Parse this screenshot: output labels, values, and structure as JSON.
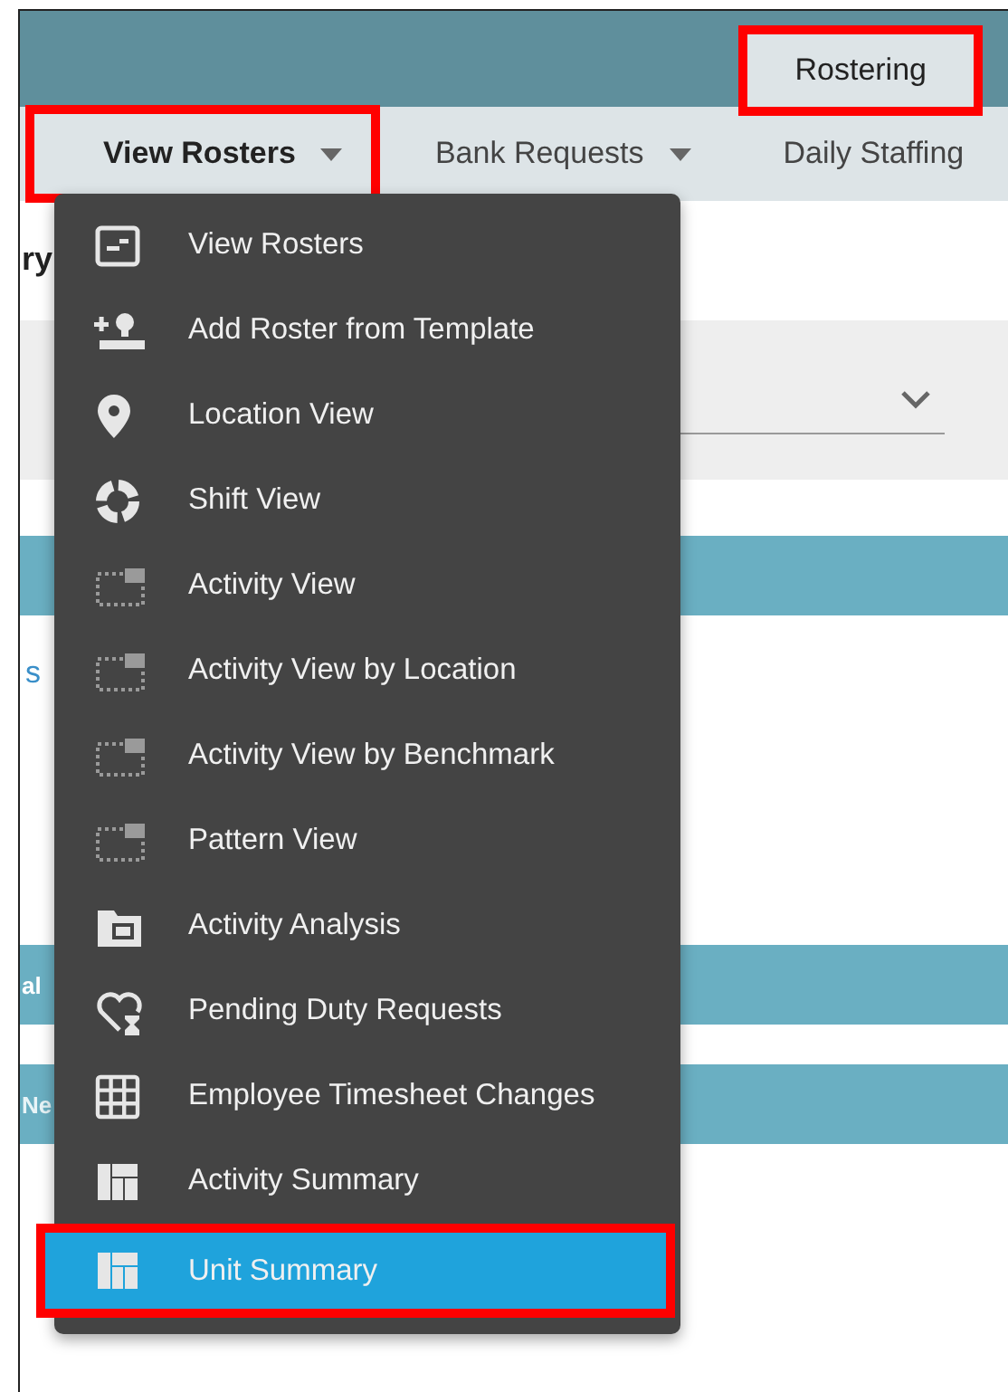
{
  "top_bar": {
    "tabs": [
      {
        "label": "Rostering",
        "selected": true,
        "highlighted": true
      }
    ]
  },
  "nav": {
    "items": [
      {
        "label": "View Rosters",
        "selected": true,
        "highlighted": true,
        "has_caret": true
      },
      {
        "label": "Bank Requests",
        "selected": false,
        "highlighted": false,
        "has_caret": true
      },
      {
        "label": "Daily Staffing",
        "selected": false,
        "highlighted": false,
        "has_caret": false
      }
    ]
  },
  "page": {
    "heading": "ry",
    "link": "s",
    "bands": [
      "al",
      "Ne"
    ]
  },
  "menu": {
    "items": [
      {
        "label": "View Rosters",
        "selected": false,
        "highlighted": false
      },
      {
        "label": "Add Roster from Template",
        "selected": false,
        "highlighted": false
      },
      {
        "label": "Location View",
        "selected": false,
        "highlighted": false
      },
      {
        "label": "Shift View",
        "selected": false,
        "highlighted": false
      },
      {
        "label": "Activity View",
        "selected": false,
        "highlighted": false
      },
      {
        "label": "Activity View by Location",
        "selected": false,
        "highlighted": false
      },
      {
        "label": "Activity View by Benchmark",
        "selected": false,
        "highlighted": false
      },
      {
        "label": "Pattern View",
        "selected": false,
        "highlighted": false
      },
      {
        "label": "Activity Analysis",
        "selected": false,
        "highlighted": false
      },
      {
        "label": "Pending Duty Requests",
        "selected": false,
        "highlighted": false
      },
      {
        "label": "Employee Timesheet Changes",
        "selected": false,
        "highlighted": false
      },
      {
        "label": "Activity Summary",
        "selected": false,
        "highlighted": false
      },
      {
        "label": "Unit Summary",
        "selected": true,
        "highlighted": true
      }
    ]
  }
}
